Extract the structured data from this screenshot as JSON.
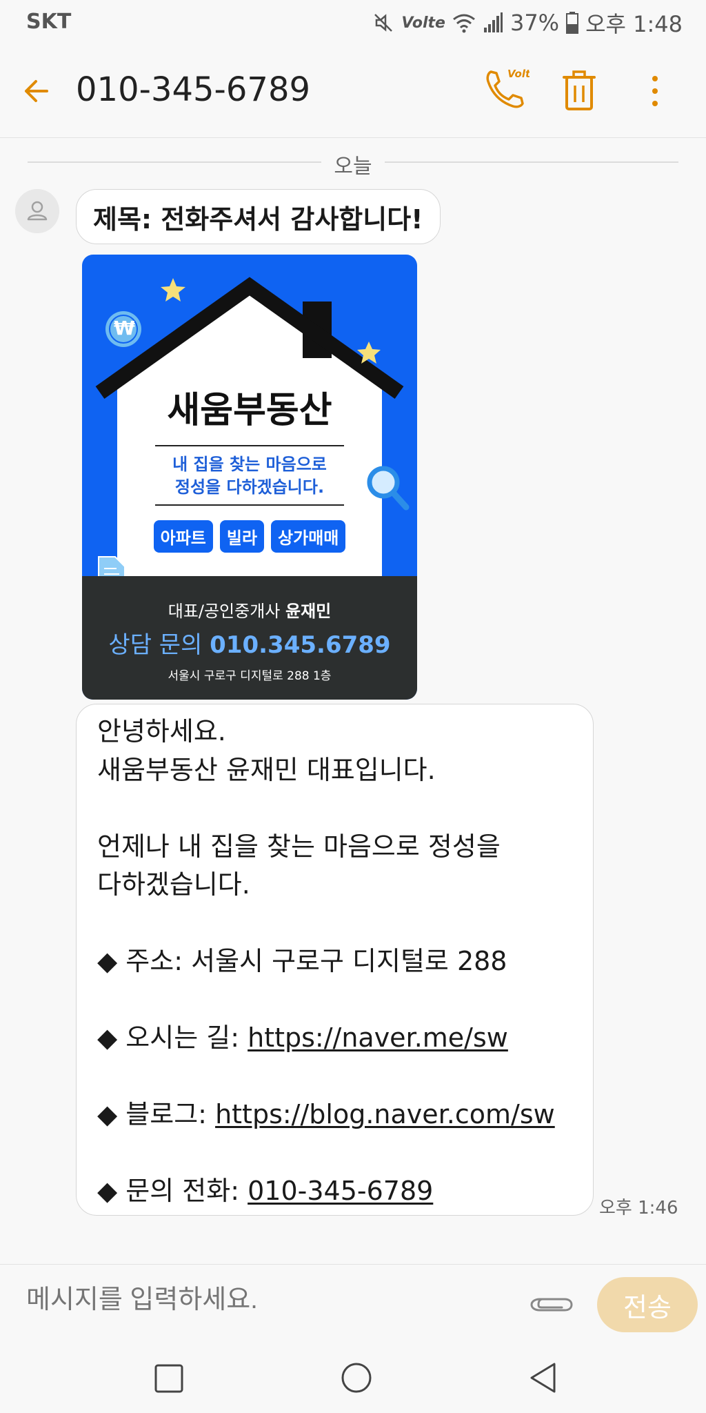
{
  "status_bar": {
    "carrier": "SKT",
    "volte_label": "Volte",
    "battery": "37%",
    "time": "오후 1:48"
  },
  "header": {
    "contact": "010-345-6789",
    "icons": [
      "back-arrow-icon",
      "volte-call-icon",
      "trash-icon",
      "more-vertical-icon"
    ],
    "call_badge": "Volte"
  },
  "thread": {
    "date_divider": "오늘",
    "subject": "제목: 전화주셔서 감사합니다!",
    "image_card": {
      "title": "새움부동산",
      "slogan_line1": "내 집을 찾는 마음으로",
      "slogan_line2": "정성을 다하겠습니다.",
      "tags": [
        "아파트",
        "빌라",
        "상가매매"
      ],
      "ceo_label": "대표/공인중개사",
      "ceo_name": "윤재민",
      "contact_label": "상담 문의",
      "contact_phone": "010.345.6789",
      "address": "서울시 구로구 디지털로 288 1층",
      "won_symbol": "₩"
    },
    "message": {
      "line1": "안녕하세요.",
      "line2": "새움부동산 윤재민 대표입니다.",
      "line3": "언제나 내 집을 찾는 마음으로 정성을",
      "line4": "다하겠습니다.",
      "address_label": "◆ 주소: ",
      "address_value": "서울시 구로구 디지털로 288",
      "directions_label": "◆ 오시는 길: ",
      "directions_link": "https://naver.me/sw",
      "blog_label": "◆ 블로그: ",
      "blog_link": "https://blog.naver.com/sw",
      "phone_label": "◆ 문의 전화: ",
      "phone_link": "010-345-6789"
    },
    "time": "오후 1:46"
  },
  "composer": {
    "placeholder": "메시지를 입력하세요.",
    "send_label": "전송"
  },
  "colors": {
    "accent": "#e08a00",
    "card_blue": "#0f63f2",
    "card_dark": "#2c2f2f",
    "send_button": "#f1d9ab"
  }
}
